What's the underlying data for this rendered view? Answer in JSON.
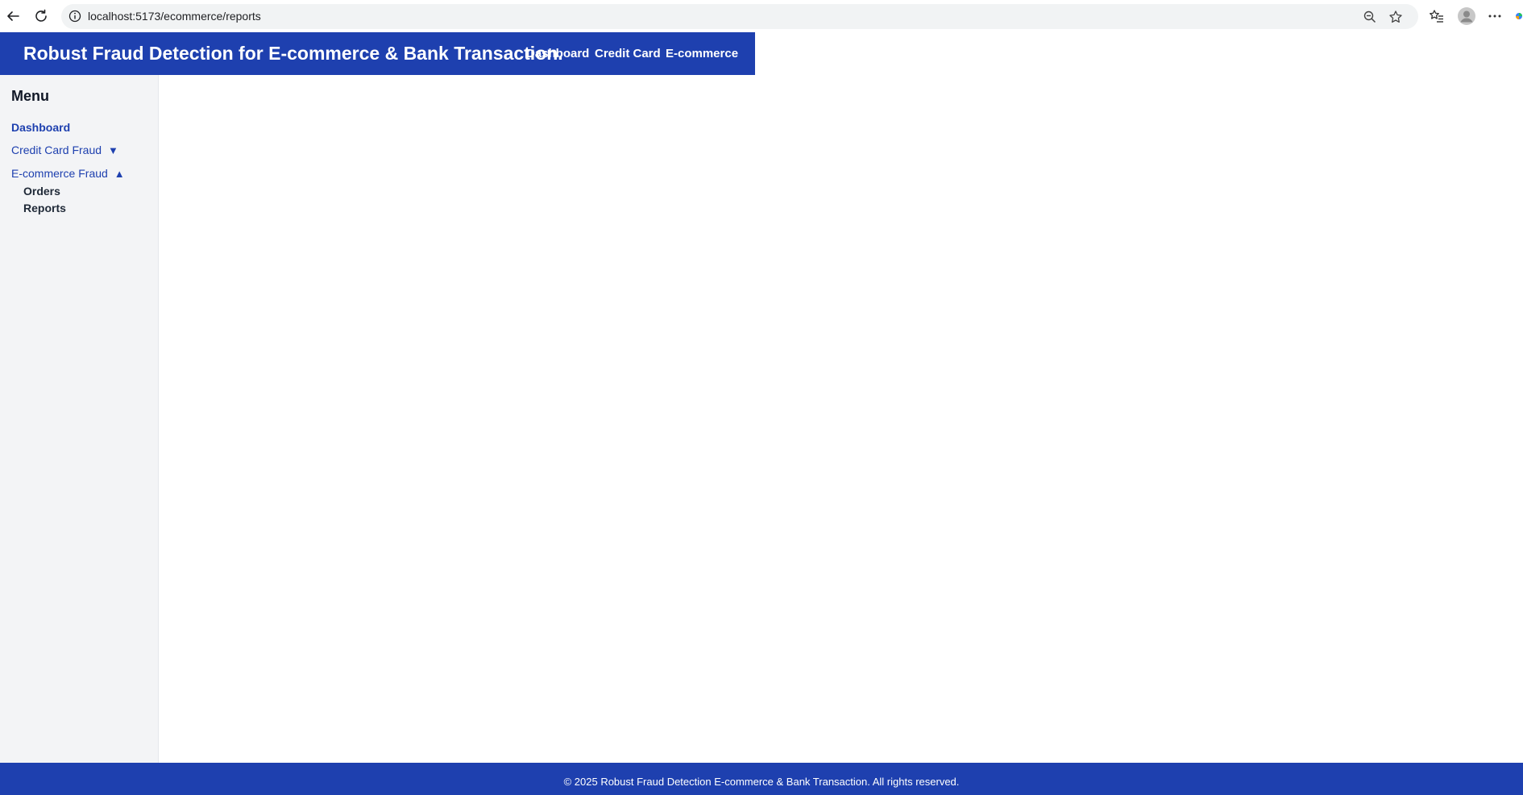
{
  "browser": {
    "url": "localhost:5173/ecommerce/reports",
    "icons": [
      "back-arrow-icon",
      "reload-icon",
      "site-info-icon",
      "zoom-out-icon",
      "favorite-star-icon",
      "favorites-list-icon",
      "profile-avatar-icon",
      "more-menu-icon",
      "copilot-icon"
    ]
  },
  "header": {
    "title": "Robust Fraud Detection for E-commerce & Bank Transaction.",
    "links": [
      "Dashboard",
      "Credit Card",
      "E-commerce"
    ]
  },
  "sidebar": {
    "heading": "Menu",
    "items": [
      {
        "label": "Dashboard"
      },
      {
        "label": "Credit Card Fraud",
        "caret": "▼"
      },
      {
        "label": "E-commerce Fraud",
        "caret": "▲"
      }
    ],
    "subitems": [
      {
        "label": "Orders"
      },
      {
        "label": "Reports"
      }
    ]
  },
  "footer": {
    "text": "© 2025 Robust Fraud Detection E-commerce & Bank Transaction. All rights reserved."
  },
  "colors": {
    "brand": "#1e40af",
    "sidebar_bg": "#f3f4f6"
  }
}
